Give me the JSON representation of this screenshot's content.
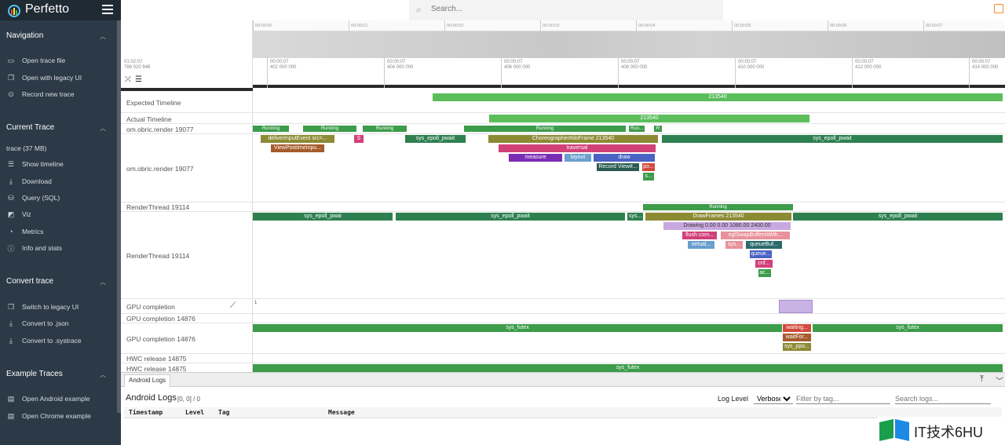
{
  "app": {
    "title": "Perfetto"
  },
  "search": {
    "placeholder": "Search..."
  },
  "sidebar": {
    "sections": [
      {
        "title": "Navigation",
        "items": [
          "Open trace file",
          "Open with legacy UI",
          "Record new trace"
        ]
      },
      {
        "title": "Current Trace",
        "info": "trace (37 MB)",
        "items": [
          "Show timeline",
          "Download",
          "Query (SQL)",
          "Viz",
          "Metrics",
          "Info and stats"
        ]
      },
      {
        "title": "Convert trace",
        "items": [
          "Switch to legacy UI",
          "Convert to .json",
          "Convert to .systrace"
        ]
      },
      {
        "title": "Example Traces",
        "items": [
          "Open Android example",
          "Open Chrome example"
        ]
      }
    ]
  },
  "overview": {
    "ticks": [
      "00:00:00",
      "00:00:01",
      "00:00:02",
      "00:00:03",
      "00:00:04",
      "00:00:05",
      "00:00:06",
      "00:00:07",
      "00:00:08"
    ]
  },
  "ruler": {
    "offset_a": "01:02:07",
    "offset_b": "788 020 946",
    "ticks": [
      [
        "00:00:07",
        "402 000 000"
      ],
      [
        "00:00:07",
        "404 000 000"
      ],
      [
        "00:00:07",
        "406 000 000"
      ],
      [
        "00:00:07",
        "408 000 000"
      ],
      [
        "00:00:07",
        "410 000 000"
      ],
      [
        "00:00:07",
        "412 000 000"
      ],
      [
        "00:00:07",
        "414 000 000"
      ]
    ]
  },
  "tracks": {
    "expected": "Expected Timeline",
    "actual": "Actual Timeline",
    "main1": "om.obric.render 19077",
    "main2": "om.obric.render 19077",
    "rt1": "RenderThread 19114",
    "rt2": "RenderThread 19114",
    "gpu": "GPU completion",
    "gpu1": "GPU completion 14876",
    "gpu2": "GPU completion 14876",
    "hwc1": "HWC release 14875",
    "hwc2": "HWC release 14875",
    "gpu_counter": "1"
  },
  "slices": {
    "frame_id": "213540",
    "running": "Running",
    "run_short": "Run...",
    "r": "R",
    "deliver": "deliverInputEvent src=...",
    "viewpost": "ViewPostImeInpu...",
    "epoll": "sys_epoll_pwait",
    "epoll2": "sys_epoll_pwai",
    "epoll_sys": "sys...",
    "choreo": "Choreographer#doFrame 213540",
    "traversal": "traversal",
    "measure": "measure",
    "layout": "layout",
    "draw": "draw",
    "record": "Record View#...",
    "po": "po...",
    "s": "s...",
    "S": "S",
    "drawframes": "DrawFrames 213540",
    "drawing": "Drawing 0.00 0.00 1080.00 2400.00",
    "flush": "flush com...",
    "egl": "eglSwapBuffersWith...",
    "virtual": "virtual...",
    "sys": "sys...",
    "queuebuf": "queueBuf...",
    "queue": "queue...",
    "cnf": "cnf...",
    "ac": "ac...",
    "futex": "sys_futex",
    "waiting": "waiting...",
    "waitfor": "waitFor...",
    "syspp": "sys_ppo..."
  },
  "logs": {
    "tab": "Android Logs",
    "title": "Android Logs",
    "range": "[0, 0] / 0",
    "level_label": "Log Level",
    "level_value": "Verbose",
    "filter_placeholder": "Filter by tag...",
    "search_placeholder": "Search logs...",
    "columns": [
      "Timestamp",
      "Level",
      "Tag",
      "Message"
    ]
  },
  "watermark": {
    "text": "IT技术6HU"
  },
  "colors": {
    "sidebar": "#2c3a47",
    "running": "#3c9c4a",
    "accent": "#f5891f"
  }
}
